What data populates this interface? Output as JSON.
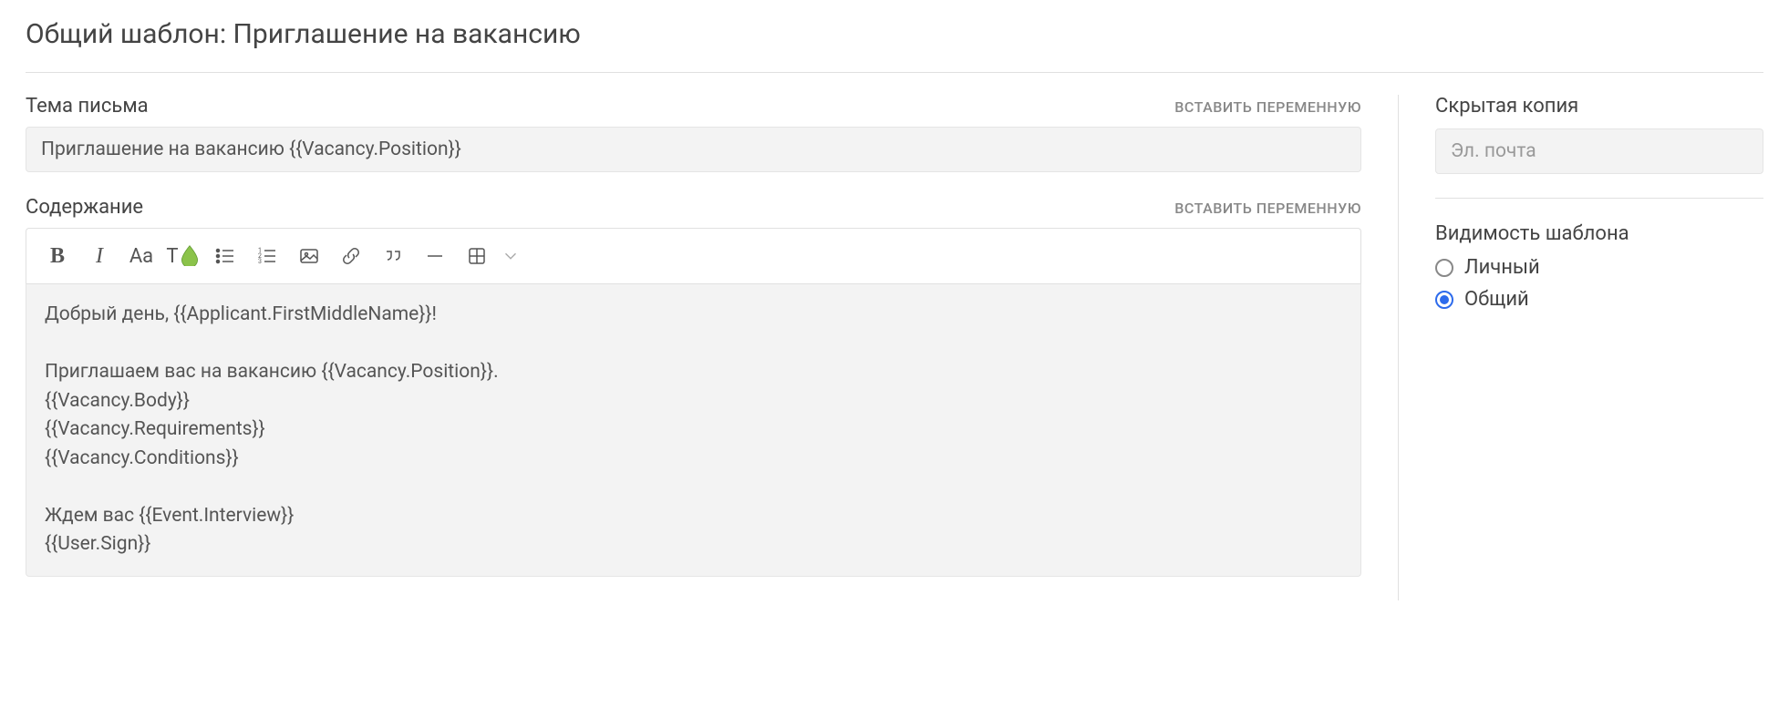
{
  "page": {
    "title": "Общий шаблон: Приглашение на вакансию"
  },
  "subject": {
    "label": "Тема письма",
    "insert_variable": "ВСТАВИТЬ ПЕРЕМЕННУЮ",
    "value": "Приглашение на вакансию {{Vacancy.Position}}"
  },
  "content": {
    "label": "Содержание",
    "insert_variable": "ВСТАВИТЬ ПЕРЕМЕННУЮ",
    "body": "Добрый день, {{Applicant.FirstMiddleName}}!\n\nПриглашаем вас на вакансию {{Vacancy.Position}}.\n{{Vacancy.Body}}\n{{Vacancy.Requirements}}\n{{Vacancy.Conditions}}\n\nЖдем вас {{Event.Interview}}\n{{User.Sign}}"
  },
  "toolbar": {
    "bold": "B",
    "italic": "I",
    "fontsize": "Aa",
    "textcolor": "T"
  },
  "bcc": {
    "label": "Скрытая копия",
    "placeholder": "Эл. почта",
    "value": ""
  },
  "visibility": {
    "label": "Видимость шаблона",
    "options": {
      "personal": "Личный",
      "shared": "Общий"
    },
    "selected": "shared"
  }
}
